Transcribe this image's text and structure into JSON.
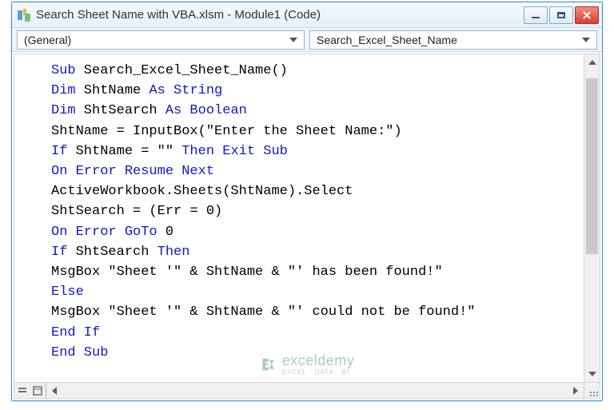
{
  "window": {
    "title": "Search Sheet Name with VBA.xlsm - Module1 (Code)"
  },
  "dropdowns": {
    "object": "(General)",
    "procedure": "Search_Excel_Sheet_Name"
  },
  "code": {
    "tokens": [
      [
        [
          "kw",
          "Sub"
        ],
        [
          "",
          " Search_Excel_Sheet_Name()"
        ]
      ],
      [
        [
          "kw",
          "Dim"
        ],
        [
          "",
          " ShtName "
        ],
        [
          "kw",
          "As String"
        ]
      ],
      [
        [
          "kw",
          "Dim"
        ],
        [
          "",
          " ShtSearch "
        ],
        [
          "kw",
          "As Boolean"
        ]
      ],
      [
        [
          "",
          "ShtName = InputBox(\"Enter the Sheet Name:\")"
        ]
      ],
      [
        [
          "kw",
          "If"
        ],
        [
          "",
          " ShtName = \"\" "
        ],
        [
          "kw",
          "Then Exit Sub"
        ]
      ],
      [
        [
          "kw",
          "On Error Resume Next"
        ]
      ],
      [
        [
          "",
          "ActiveWorkbook.Sheets(ShtName).Select"
        ]
      ],
      [
        [
          "",
          "ShtSearch = (Err = 0)"
        ]
      ],
      [
        [
          "kw",
          "On Error GoTo"
        ],
        [
          "",
          " 0"
        ]
      ],
      [
        [
          "kw",
          "If"
        ],
        [
          "",
          " ShtSearch "
        ],
        [
          "kw",
          "Then"
        ]
      ],
      [
        [
          "",
          "MsgBox \"Sheet '\" & ShtName & \"' has been found!\""
        ]
      ],
      [
        [
          "kw",
          "Else"
        ]
      ],
      [
        [
          "",
          "MsgBox \"Sheet '\" & ShtName & \"' could not be found!\""
        ]
      ],
      [
        [
          "kw",
          "End If"
        ]
      ],
      [
        [
          "kw",
          "End Sub"
        ]
      ]
    ]
  },
  "watermark": {
    "main": "exceldemy",
    "sub": "EXCEL · DATA · BI"
  }
}
